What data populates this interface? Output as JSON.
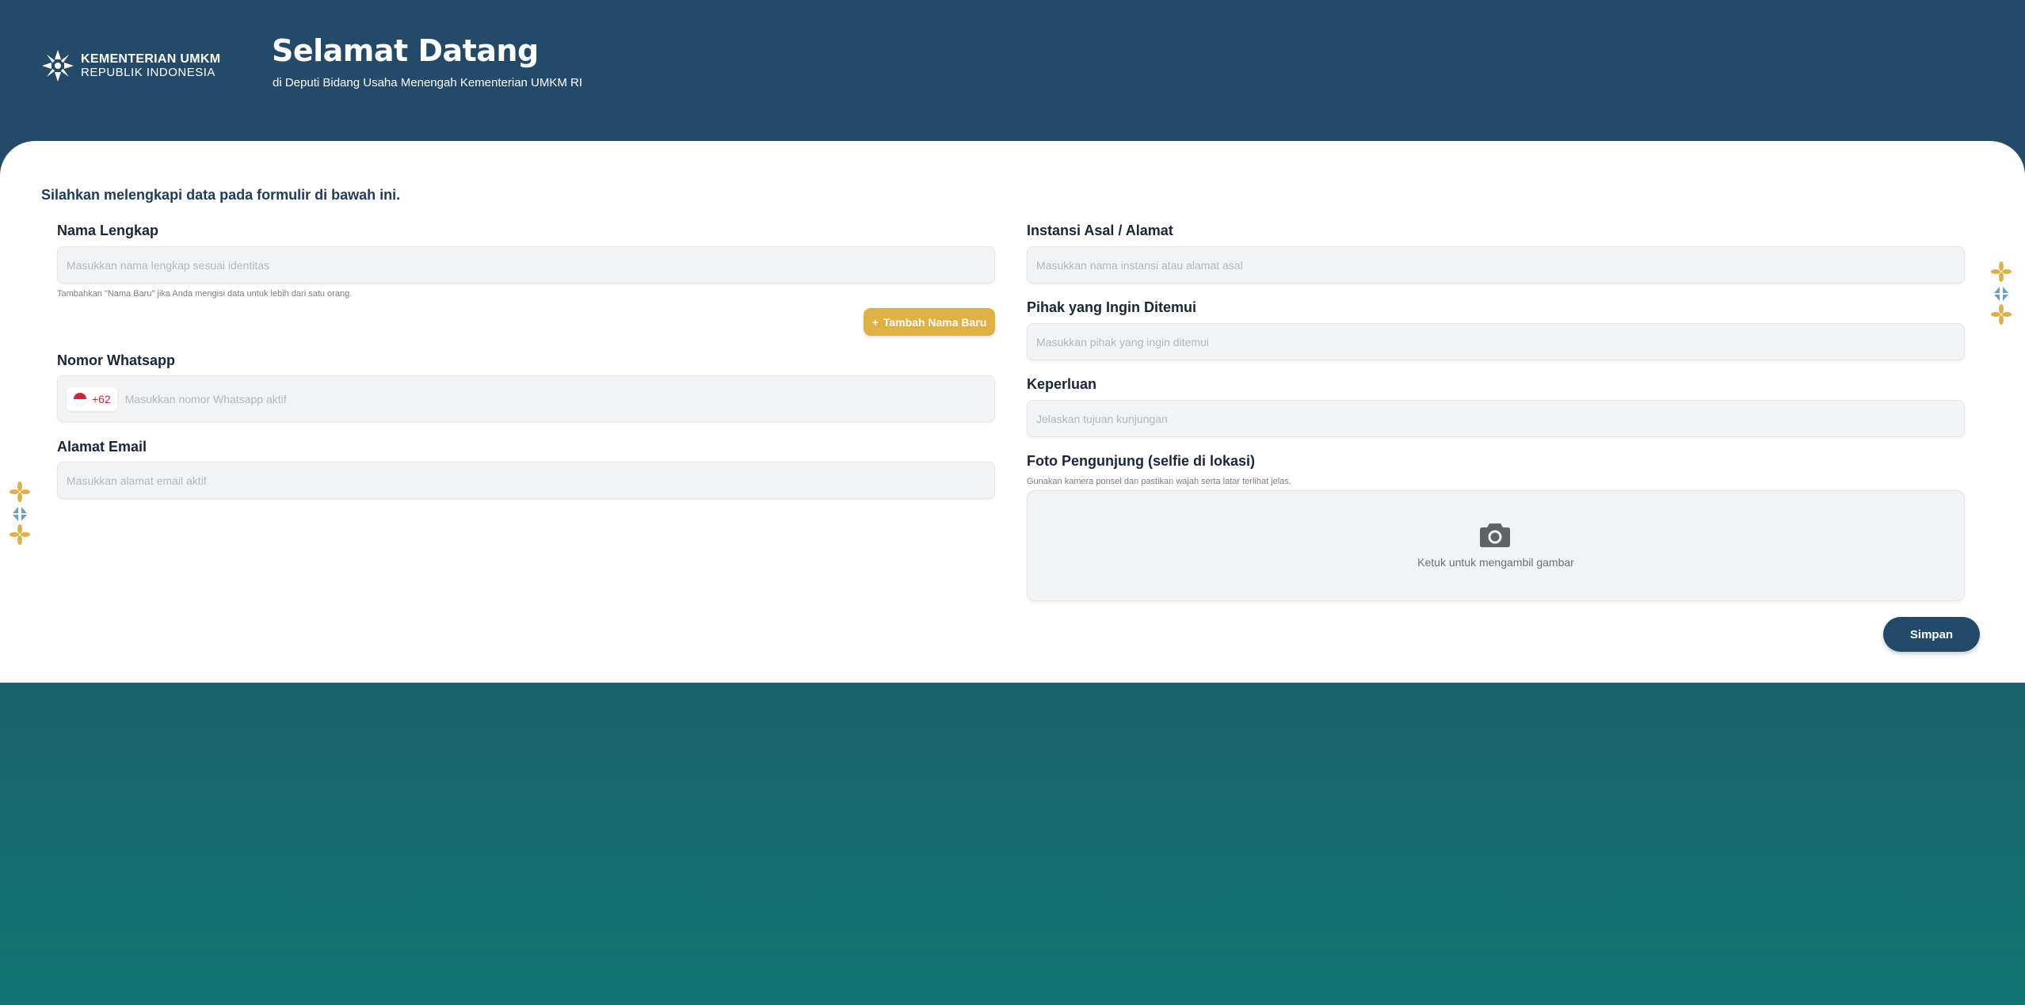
{
  "header": {
    "logo": {
      "line1": "KEMENTERIAN UMKM",
      "line2": "REPUBLIK INDONESIA"
    },
    "title": "Selamat Datang",
    "subtitle": "di Deputi Bidang Usaha Menengah Kementerian UMKM RI"
  },
  "form": {
    "intro": "Silahkan melengkapi data pada formulir di bawah ini.",
    "nama": {
      "label": "Nama Lengkap",
      "placeholder": "Masukkan nama lengkap sesuai identitas",
      "hint": "Tambahkan \"Nama Baru\" jika Anda mengisi data untuk lebih dari satu orang."
    },
    "add_name_button": {
      "icon": "+",
      "label": "Tambah Nama Baru"
    },
    "whatsapp": {
      "label": "Nomor Whatsapp",
      "prefix": "+62",
      "placeholder": "Masukkan nomor Whatsapp aktif"
    },
    "email": {
      "label": "Alamat Email",
      "placeholder": "Masukkan alamat email aktif"
    },
    "instansi": {
      "label": "Instansi Asal / Alamat",
      "placeholder": "Masukkan nama instansi atau alamat asal"
    },
    "pihak": {
      "label": "Pihak yang Ingin Ditemui",
      "placeholder": "Masukkan pihak yang ingin ditemui"
    },
    "keperluan": {
      "label": "Keperluan",
      "placeholder": "Jelaskan tujuan kunjungan"
    },
    "foto": {
      "label": "Foto Pengunjung (selfie di lokasi)",
      "hint": "Gunakan kamera ponsel dan pastikan wajah serta latar terlihat jelas.",
      "action_text": "Ketuk untuk mengambil gambar"
    },
    "save_button": "Simpan"
  },
  "colors": {
    "header_bg": "#244a6a",
    "accent_gold": "#dfb043",
    "accent_blue": "#6aa1bf",
    "bottom_teal": "#127572"
  }
}
